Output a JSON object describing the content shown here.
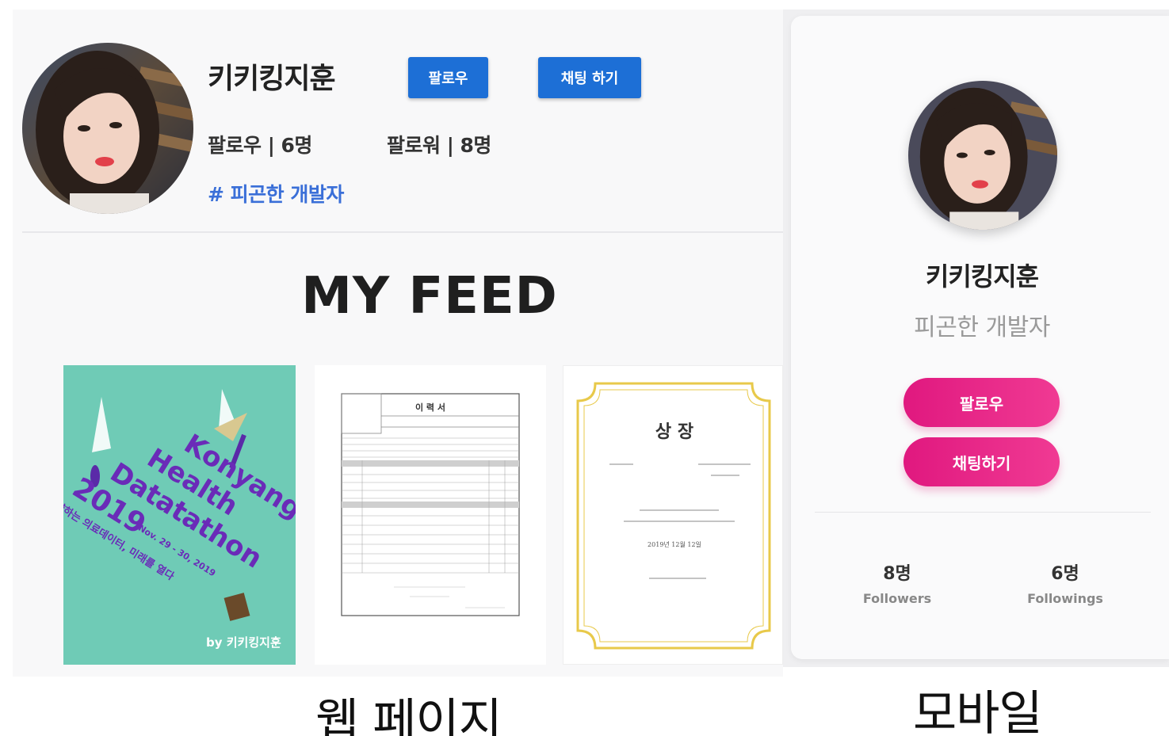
{
  "web": {
    "profile": {
      "name": "키키킹지훈",
      "follow_button": "팔로우",
      "chat_button": "채팅 하기",
      "following_stat": "팔로우 | 6명",
      "follower_stat": "팔로워 | 8명",
      "tag": "# 피곤한 개발자"
    },
    "feed": {
      "title": "MY FEED",
      "posts": [
        {
          "kind": "poster",
          "lines": [
            "Konyang",
            "Health",
            "Datatathon",
            "2019"
          ],
          "date": "Nov. 29 - 30, 2019",
          "subtitle": "도약하는 의료데이터, 미래를 열다",
          "byline": "by 키키킹지훈"
        },
        {
          "kind": "resume",
          "title": "이 력 서"
        },
        {
          "kind": "certificate",
          "title": "상 장",
          "date": "2019년 12월 12일"
        }
      ]
    },
    "caption": "웹 페이지"
  },
  "mobile": {
    "name": "키키킹지훈",
    "bio": "피곤한 개발자",
    "follow_button": "팔로우",
    "chat_button": "채팅하기",
    "stats": [
      {
        "value": "8명",
        "label": "Followers"
      },
      {
        "value": "6명",
        "label": "Followings"
      }
    ],
    "caption": "모바일"
  },
  "colors": {
    "web_button": "#1d6fd6",
    "tag": "#3a6fd8",
    "pink_start": "#e0187f",
    "pink_end": "#f03a93",
    "poster_bg": "#6fcbb6",
    "poster_text": "#6a2bb8",
    "certificate_border": "#e8c94a"
  }
}
